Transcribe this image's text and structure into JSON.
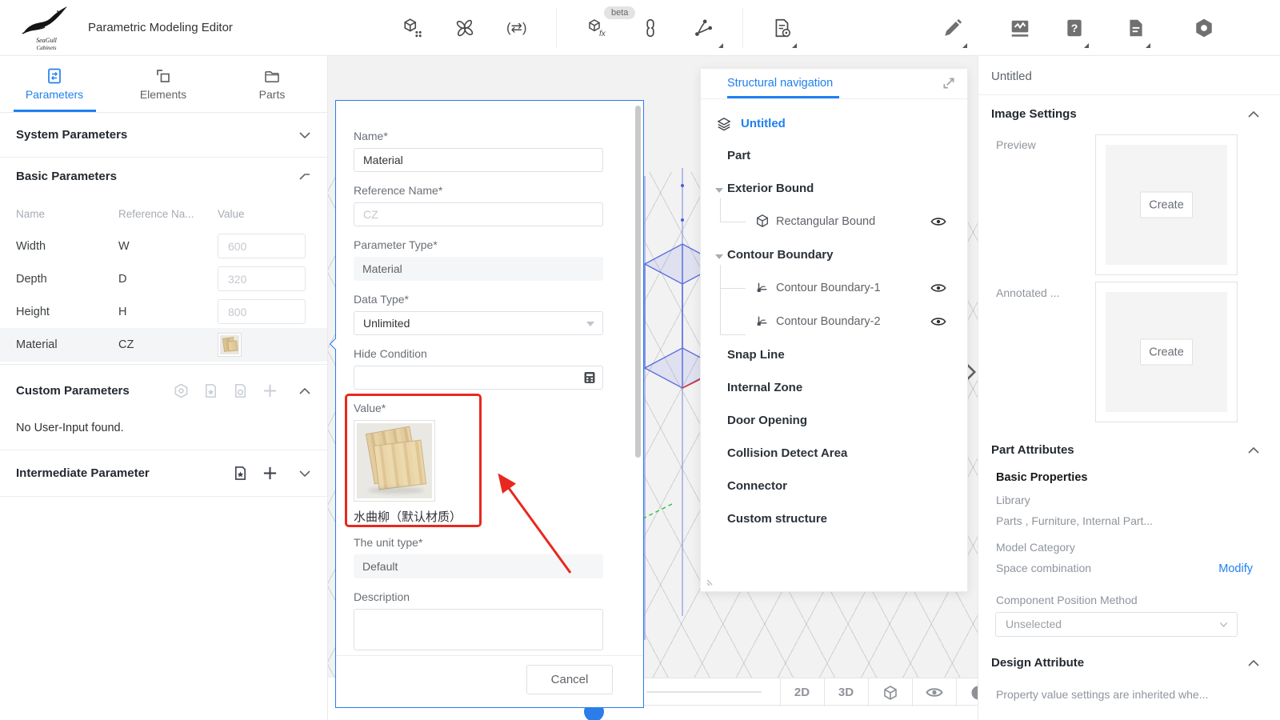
{
  "colors": {
    "accent": "#2080f0",
    "modal_border": "#2b7de9",
    "annotation_red": "#e8281e",
    "wood": "#d8c49a"
  },
  "topbar": {
    "title": "Parametric Modeling Editor",
    "beta_badge": "beta",
    "logo": {
      "line1": "SeaGull",
      "line2": "Cabinets"
    },
    "icon_names": [
      "component-library-icon",
      "knot-icon",
      "swap-icon",
      "cube-fx-icon",
      "link-icon",
      "share-icon",
      "new-document-icon",
      "edit-pencil-icon",
      "activity-monitor-icon",
      "help-icon",
      "document-report-icon",
      "settings-nut-icon"
    ],
    "swap_glyph": "(⇄)"
  },
  "left_panel": {
    "tabs": [
      {
        "label": "Parameters",
        "active": true
      },
      {
        "label": "Elements",
        "active": false
      },
      {
        "label": "Parts",
        "active": false
      }
    ],
    "system": {
      "title": "System Parameters"
    },
    "basic": {
      "title": "Basic Parameters",
      "columns": [
        "Name",
        "Reference Na...",
        "Value"
      ],
      "rows": [
        {
          "name": "Width",
          "ref": "W",
          "value": "600"
        },
        {
          "name": "Depth",
          "ref": "D",
          "value": "320"
        },
        {
          "name": "Height",
          "ref": "H",
          "value": "800"
        },
        {
          "name": "Material",
          "ref": "CZ",
          "value_type": "texture-swatch"
        }
      ]
    },
    "custom": {
      "title": "Custom Parameters",
      "empty_text": "No User-Input found."
    },
    "intermediate": {
      "title": "Intermediate Parameter"
    }
  },
  "modal": {
    "fields": {
      "name": {
        "label": "Name*",
        "value": "Material"
      },
      "reference": {
        "label": "Reference Name*",
        "placeholder": "CZ"
      },
      "param_type": {
        "label": "Parameter Type*",
        "value": "Material"
      },
      "data_type": {
        "label": "Data Type*",
        "value": "Unlimited"
      },
      "hide_condition": {
        "label": "Hide Condition",
        "value": ""
      },
      "value": {
        "label": "Value*",
        "material_name": "水曲柳（默认材质）"
      },
      "unit_type": {
        "label": "The unit type*",
        "value": "Default"
      },
      "description": {
        "label": "Description",
        "value": ""
      }
    },
    "cancel_label": "Cancel"
  },
  "structure_panel": {
    "title": "Structural navigation",
    "tree": [
      {
        "label": "Untitled"
      },
      {
        "label": "Part"
      },
      {
        "label": "Exterior Bound"
      },
      {
        "label": "Rectangular Bound"
      },
      {
        "label": "Contour Boundary"
      },
      {
        "label": "Contour Boundary-1"
      },
      {
        "label": "Contour Boundary-2"
      },
      {
        "label": "Snap Line"
      },
      {
        "label": "Internal Zone"
      },
      {
        "label": "Door Opening"
      },
      {
        "label": "Collision Detect Area"
      },
      {
        "label": "Connector"
      },
      {
        "label": "Custom structure"
      }
    ]
  },
  "right_panel": {
    "title": "Untitled",
    "image_settings": {
      "title": "Image Settings",
      "preview_label": "Preview",
      "annotated_label": "Annotated ...",
      "create_label": "Create"
    },
    "part_attributes": {
      "title": "Part Attributes",
      "basic_properties": "Basic Properties",
      "library_label": "Library",
      "library_value": "Parts , Furniture, Internal Part...",
      "model_category": "Model Category",
      "space_combination": "Space combination",
      "modify_label": "Modify",
      "component_position_label": "Component Position Method",
      "component_position_value": "Unselected"
    },
    "design_attribute": {
      "title": "Design Attribute",
      "hint": "Property value settings are inherited whe..."
    }
  },
  "bottom_toolbar": {
    "labels": [
      "2D",
      "3D"
    ]
  }
}
